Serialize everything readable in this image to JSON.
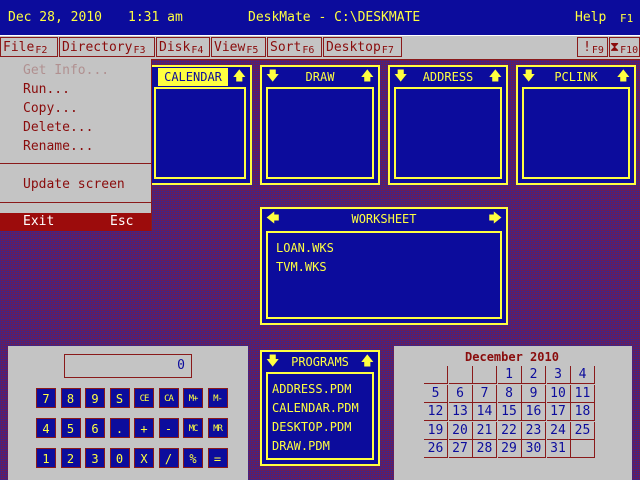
{
  "titlebar": {
    "date": "Dec 28, 2010",
    "time": "1:31 am",
    "title": "DeskMate - C:\\DESKMATE",
    "help": "Help",
    "help_key": "F1"
  },
  "menu": [
    {
      "label": "File",
      "key": "F2"
    },
    {
      "label": "Directory",
      "key": "F3"
    },
    {
      "label": "Disk",
      "key": "F4"
    },
    {
      "label": "View",
      "key": "F5"
    },
    {
      "label": "Sort",
      "key": "F6"
    },
    {
      "label": "Desktop",
      "key": "F7"
    },
    {
      "label": "!",
      "key": "F9"
    },
    {
      "label": "⧗",
      "key": "F10"
    }
  ],
  "file_menu": {
    "items": [
      "Get Info...",
      "Run...",
      "Copy...",
      "Delete...",
      "Rename..."
    ],
    "update": "Update screen",
    "exit": "Exit",
    "exit_key": "Esc"
  },
  "panels": {
    "calendar": "CALENDAR",
    "draw": "DRAW",
    "address": "ADDRESS",
    "pclink": "PCLINK",
    "worksheet": "WORKSHEET",
    "programs": "PROGRAMS"
  },
  "worksheet_files": [
    "LOAN.WKS",
    "TVM.WKS"
  ],
  "program_files": [
    "ADDRESS.PDM",
    "CALENDAR.PDM",
    "DESKTOP.PDM",
    "DRAW.PDM"
  ],
  "calculator": {
    "display": "0",
    "keys": [
      [
        "7",
        "8",
        "9",
        "S",
        "CE",
        "CA",
        "M+",
        "M-"
      ],
      [
        "4",
        "5",
        "6",
        ".",
        "+",
        "-",
        "MC",
        "MR"
      ],
      [
        "1",
        "2",
        "3",
        "0",
        "X",
        "/",
        "%",
        "="
      ]
    ]
  },
  "calendar_widget": {
    "title": "December 2010",
    "weeks": [
      [
        "",
        "",
        "",
        "1",
        "2",
        "3",
        "4"
      ],
      [
        "5",
        "6",
        "7",
        "8",
        "9",
        "10",
        "11"
      ],
      [
        "12",
        "13",
        "14",
        "15",
        "16",
        "17",
        "18"
      ],
      [
        "19",
        "20",
        "21",
        "22",
        "23",
        "24",
        "25"
      ],
      [
        "26",
        "27",
        "28",
        "29",
        "30",
        "31",
        ""
      ]
    ]
  },
  "colors": {
    "accent": "#ffff40",
    "panel": "#0c0c9c",
    "menu": "#c4c4c4",
    "menu_text": "#8a0c0c"
  }
}
